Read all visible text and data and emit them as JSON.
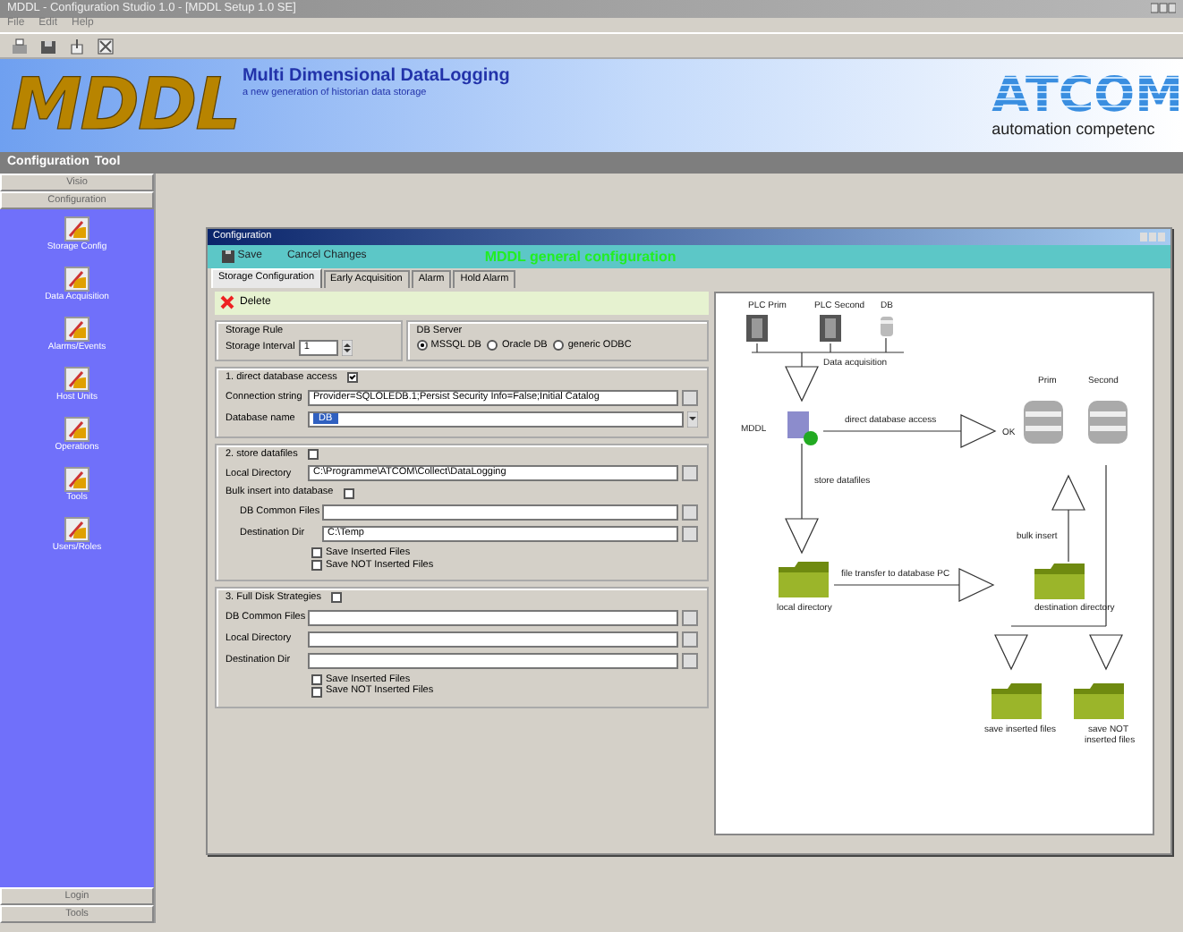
{
  "window": {
    "title": "MDDL - Configuration Studio 1.0 - [MDDL Setup 1.0 SE]"
  },
  "menu": [
    "File",
    "Edit",
    "Help"
  ],
  "banner": {
    "logo": "MDDL",
    "title": "Multi Dimensional DataLogging",
    "subtitle": "a new generation of historian data storage",
    "brand": "ATCOM",
    "brand_tagline": "automation competenc"
  },
  "section_bar": [
    "Configuration",
    "Tool"
  ],
  "sidebar": {
    "top": [
      "Visio",
      "Configuration"
    ],
    "items": [
      {
        "label": "Storage Config"
      },
      {
        "label": "Data Acquisition"
      },
      {
        "label": "Alarms/Events"
      },
      {
        "label": "Host Units"
      },
      {
        "label": "Operations"
      },
      {
        "label": "Tools"
      },
      {
        "label": "Users/Roles"
      }
    ],
    "bottom": [
      "Login",
      "Tools"
    ]
  },
  "config_window": {
    "title": "Configuration",
    "actions": [
      "Save",
      "Cancel Changes"
    ],
    "heading": "MDDL general configuration",
    "tabs": [
      {
        "label": "Storage Configuration",
        "selected": true
      },
      {
        "label": "Early Acquisition",
        "selected": false
      },
      {
        "label": "Alarm",
        "selected": false
      },
      {
        "label": "Hold Alarm",
        "selected": false
      }
    ],
    "delete": "Delete",
    "storage_rule": {
      "title": "Storage Rule",
      "label": "Storage Interval",
      "value": "1"
    },
    "db_server": {
      "title": "DB Server",
      "options": [
        {
          "label": "MSSQL DB",
          "selected": true
        },
        {
          "label": "Oracle DB",
          "selected": false
        },
        {
          "label": "generic ODBC",
          "selected": false
        }
      ]
    },
    "sections": [
      {
        "title": "1. direct database access",
        "checked": true,
        "rows": [
          {
            "kind": "field",
            "label": "Connection string",
            "value": "Provider=SQLOLEDB.1;Persist Security Info=False;Initial Catalog"
          },
          {
            "kind": "dropdown",
            "label": "Database name",
            "value": "DB"
          }
        ]
      },
      {
        "title": "2. store datafiles",
        "checked": false,
        "rows": [
          {
            "kind": "field",
            "label": "Local Directory",
            "value": "C:\\Programme\\ATCOM\\Collect\\DataLogging"
          },
          {
            "kind": "checkbox",
            "label": "Bulk insert into database",
            "checked": false
          },
          {
            "kind": "field",
            "label": "DB Common Files",
            "value": ""
          },
          {
            "kind": "field",
            "label": "Destination Dir",
            "value": "C:\\Temp"
          },
          {
            "kind": "option",
            "label": "Save Inserted Files",
            "checked": false
          },
          {
            "kind": "option",
            "label": "Save NOT Inserted Files",
            "checked": false
          }
        ]
      },
      {
        "title": "3. Full Disk Strategies",
        "checked": false,
        "rows": [
          {
            "kind": "field",
            "label": "DB Common Files",
            "value": ""
          },
          {
            "kind": "field",
            "label": "Local Directory",
            "value": ""
          },
          {
            "kind": "field",
            "label": "Destination Dir",
            "value": ""
          },
          {
            "kind": "option",
            "label": "Save Inserted Files",
            "checked": false
          },
          {
            "kind": "option",
            "label": "Save NOT Inserted Files",
            "checked": false
          }
        ]
      }
    ],
    "diagram": {
      "labels": [
        "PLC Prim",
        "PLC Second",
        "DB",
        "Data acquisition",
        "MDDL",
        "direct database access",
        "OK",
        "Prim",
        "Second",
        "store datafiles",
        "local directory",
        "file transfer to database PC",
        "bulk insert",
        "destination directory",
        "save inserted files",
        "save NOT",
        "inserted files"
      ]
    }
  }
}
